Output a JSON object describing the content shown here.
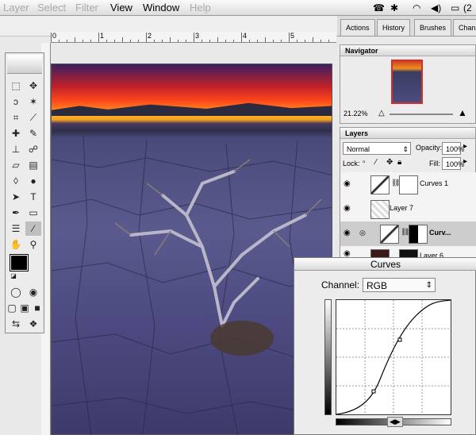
{
  "menubar": {
    "items": [
      {
        "label": "Layer",
        "enabled": false
      },
      {
        "label": "Select",
        "enabled": false
      },
      {
        "label": "Filter",
        "enabled": false
      },
      {
        "label": "View",
        "enabled": true
      },
      {
        "label": "Window",
        "enabled": true
      },
      {
        "label": "Help",
        "enabled": false
      }
    ],
    "battery_text": "(2"
  },
  "ruler": {
    "h_labels": [
      "0",
      "1",
      "2",
      "3",
      "4",
      "5"
    ]
  },
  "panel_tabs": [
    "Actions",
    "History",
    "Brushes",
    "Channe"
  ],
  "navigator": {
    "title": "Navigator",
    "zoom": "21.22%"
  },
  "layers": {
    "title": "Layers",
    "blend_mode": "Normal",
    "opacity_label": "Opacity:",
    "opacity": "100%",
    "lock_label": "Lock:",
    "fill_label": "Fill:",
    "fill": "100%",
    "rows": [
      {
        "name": "Curves 1"
      },
      {
        "name": "Layer 7"
      },
      {
        "name": "Curv..."
      },
      {
        "name": "Layer 6"
      }
    ]
  },
  "curves": {
    "title": "Curves",
    "channel_label": "Channel:",
    "channel_value": "RGB"
  },
  "colors": {
    "accent": "#5a5a8e",
    "sky_orange": "#ff7a1c"
  }
}
